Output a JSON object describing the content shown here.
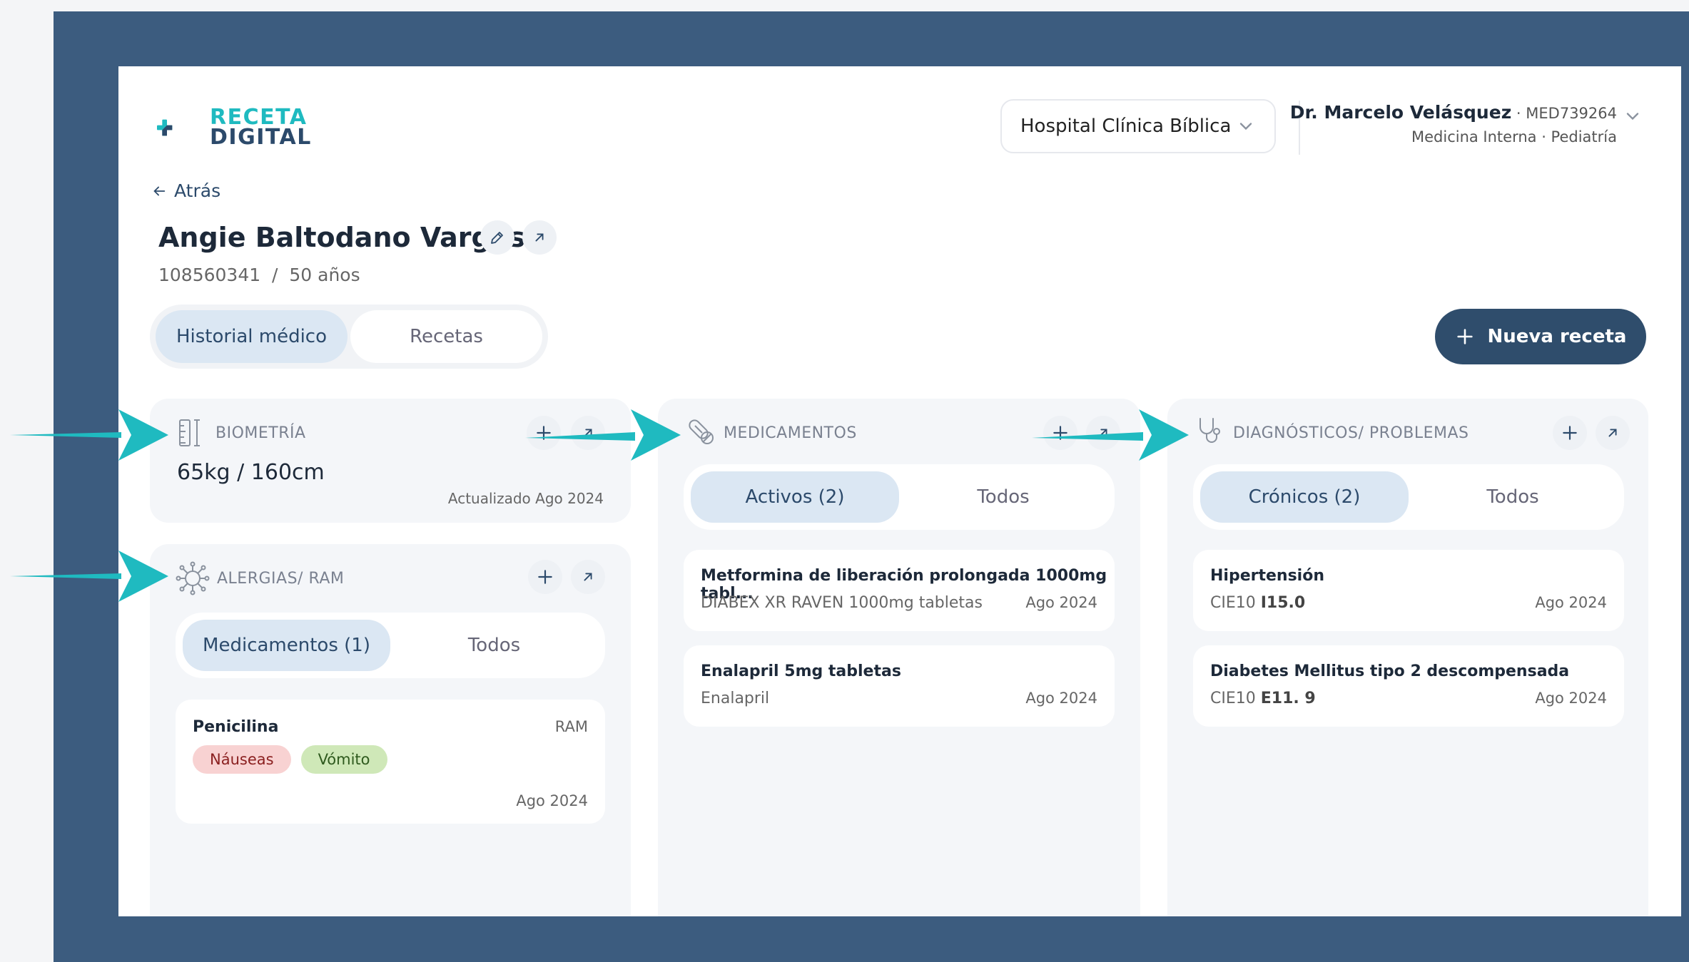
{
  "app": {
    "logo_line1": "RECETA",
    "logo_line2": "DIGITAL"
  },
  "header": {
    "hospital": "Hospital Clínica Bíblica",
    "doctor_name": "Dr. Marcelo Velásquez",
    "doctor_code": " · MED739264",
    "doctor_specialty": "Medicina Interna · Pediatría"
  },
  "patient": {
    "back_label": "Atrás",
    "name": "Angie Baltodano Vargas",
    "info": "108560341  /  50 años"
  },
  "tabs": {
    "history": "Historial médico",
    "prescriptions": "Recetas"
  },
  "new_prescription_label": "Nueva receta",
  "biometry": {
    "title": "BIOMETRÍA",
    "value": "65kg / 160cm",
    "updated": "Actualizado Ago 2024"
  },
  "allergies": {
    "title": "ALERGIAS/ RAM",
    "seg_active": "Medicamentos (1)",
    "seg_all": "Todos",
    "item": {
      "name": "Penicilina",
      "type": "RAM",
      "chips": [
        "Náuseas",
        "Vómito"
      ],
      "date": "Ago 2024"
    }
  },
  "medications": {
    "title": "MEDICAMENTOS",
    "seg_active": "Activos (2)",
    "seg_all": "Todos",
    "items": [
      {
        "title": "Metformina de liberación prolongada 1000mg tabl...",
        "sub": "DIABEX XR RAVEN 1000mg tabletas",
        "date": "Ago 2024"
      },
      {
        "title": "Enalapril 5mg tabletas",
        "sub": "Enalapril",
        "date": "Ago 2024"
      }
    ]
  },
  "diagnoses": {
    "title": "DIAGNÓSTICOS/ PROBLEMAS",
    "seg_active": "Crónicos (2)",
    "seg_all": "Todos",
    "items": [
      {
        "title": "Hipertensión",
        "code_prefix": "CIE10 ",
        "code": "I15.0",
        "date": "Ago 2024"
      },
      {
        "title": "Diabetes Mellitus tipo 2 descompensada",
        "code_prefix": "CIE10 ",
        "code": "E11. 9",
        "date": "Ago 2024"
      }
    ]
  },
  "colors": {
    "frame": "#3c5c7f",
    "accent": "#1fbac0",
    "primary": "#2f4d6c",
    "chip_red_bg": "#f8d2d2",
    "chip_green_bg": "#cfe8b8"
  },
  "icons": {
    "ruler": "ruler-icon",
    "virus": "virus-icon",
    "pill": "pill-icon",
    "stethoscope": "stethoscope-icon",
    "plus": "plus-icon",
    "expand": "expand-arrow-icon",
    "edit": "pencil-icon"
  }
}
